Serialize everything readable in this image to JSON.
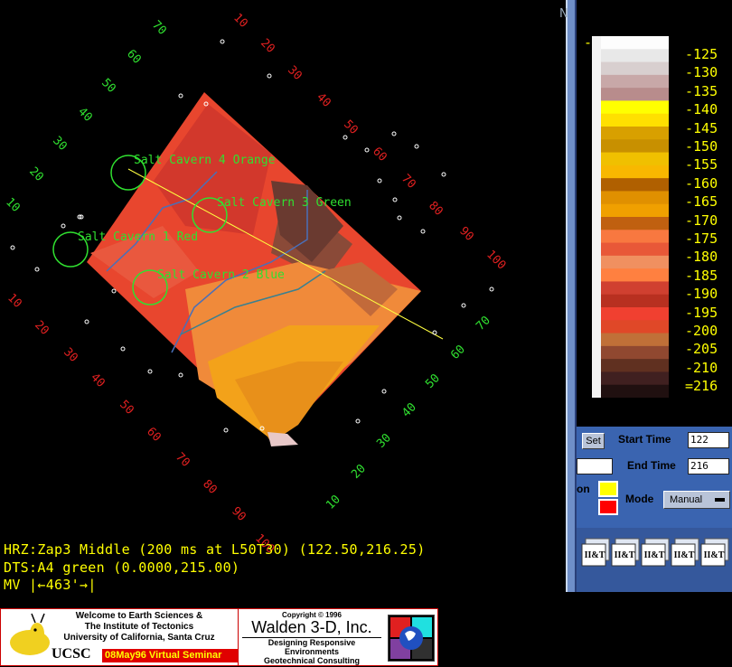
{
  "viewport": {
    "cavern_labels": [
      "Salt Cavern 4 Orange",
      "Salt Cavern 3 Green",
      "Salt Cavern 1 Red",
      "Salt Cavern 2 Blue"
    ],
    "ring_ticks_green_top": [
      "70",
      "60",
      "50",
      "40",
      "30",
      "20",
      "10"
    ],
    "ring_ticks_red_right": [
      "10",
      "20",
      "30",
      "40",
      "50",
      "60",
      "70",
      "80",
      "90",
      "100"
    ],
    "ring_ticks_green_right": [
      "70",
      "60",
      "50",
      "40",
      "30",
      "20",
      "10"
    ],
    "ring_ticks_red_left": [
      "10",
      "20",
      "30",
      "40",
      "50",
      "60",
      "70",
      "80",
      "90",
      "100"
    ]
  },
  "status": {
    "horizon": "HRZ:Zap3 Middle (200 ms at L50T30) (122.50,216.25)",
    "dataset": "DTS:A4 green (0.0000,215.00)",
    "mv_prefix": "MV",
    "mv_value": "463'"
  },
  "colorbar": {
    "labels": [
      "-125",
      "-130",
      "-135",
      "-140",
      "-145",
      "-150",
      "-155",
      "-160",
      "-165",
      "-170",
      "-175",
      "-180",
      "-185",
      "-190",
      "-195",
      "-200",
      "-205",
      "-210",
      "=216"
    ],
    "top_marker": "-",
    "colors": [
      "#fdfdfd",
      "#e8e8e8",
      "#d8cfcf",
      "#c8a8a8",
      "#b88c8c",
      "#ffff00",
      "#ffe000",
      "#d8a000",
      "#c89000",
      "#f0c000",
      "#f8b800",
      "#b06000",
      "#e09000",
      "#f0a000",
      "#c06010",
      "#f87840",
      "#e85838",
      "#f09060",
      "#ff8040",
      "#d04030",
      "#b83020",
      "#f04030",
      "#e04828",
      "#c07038",
      "#904830",
      "#603020",
      "#402020",
      "#201010"
    ]
  },
  "controls": {
    "set_label": "Set",
    "start_time_label": "Start Time",
    "start_time_value": "122",
    "end_time_label": "End Time",
    "end_time_value": "216",
    "partial_label": "on",
    "mode_label": "Mode",
    "mode_value": "Manual",
    "swatch_colors": [
      "#ffff00",
      "#ff0000"
    ]
  },
  "tiles": {
    "logo_text": "II&T"
  },
  "banner": {
    "left_line1": "Welcome to Earth Sciences &",
    "left_line2": "The Institute of Tectonics",
    "left_line3": "University of California, Santa Cruz",
    "ucsc": "UCSC",
    "seminar": "08May96 Virtual Seminar",
    "copyright": "Copyright © 1996",
    "company": "Walden 3-D, Inc.",
    "tagline1": "Designing Responsive Environments",
    "tagline2": "Geotechnical Consulting"
  },
  "top_corner_glyph": "N"
}
